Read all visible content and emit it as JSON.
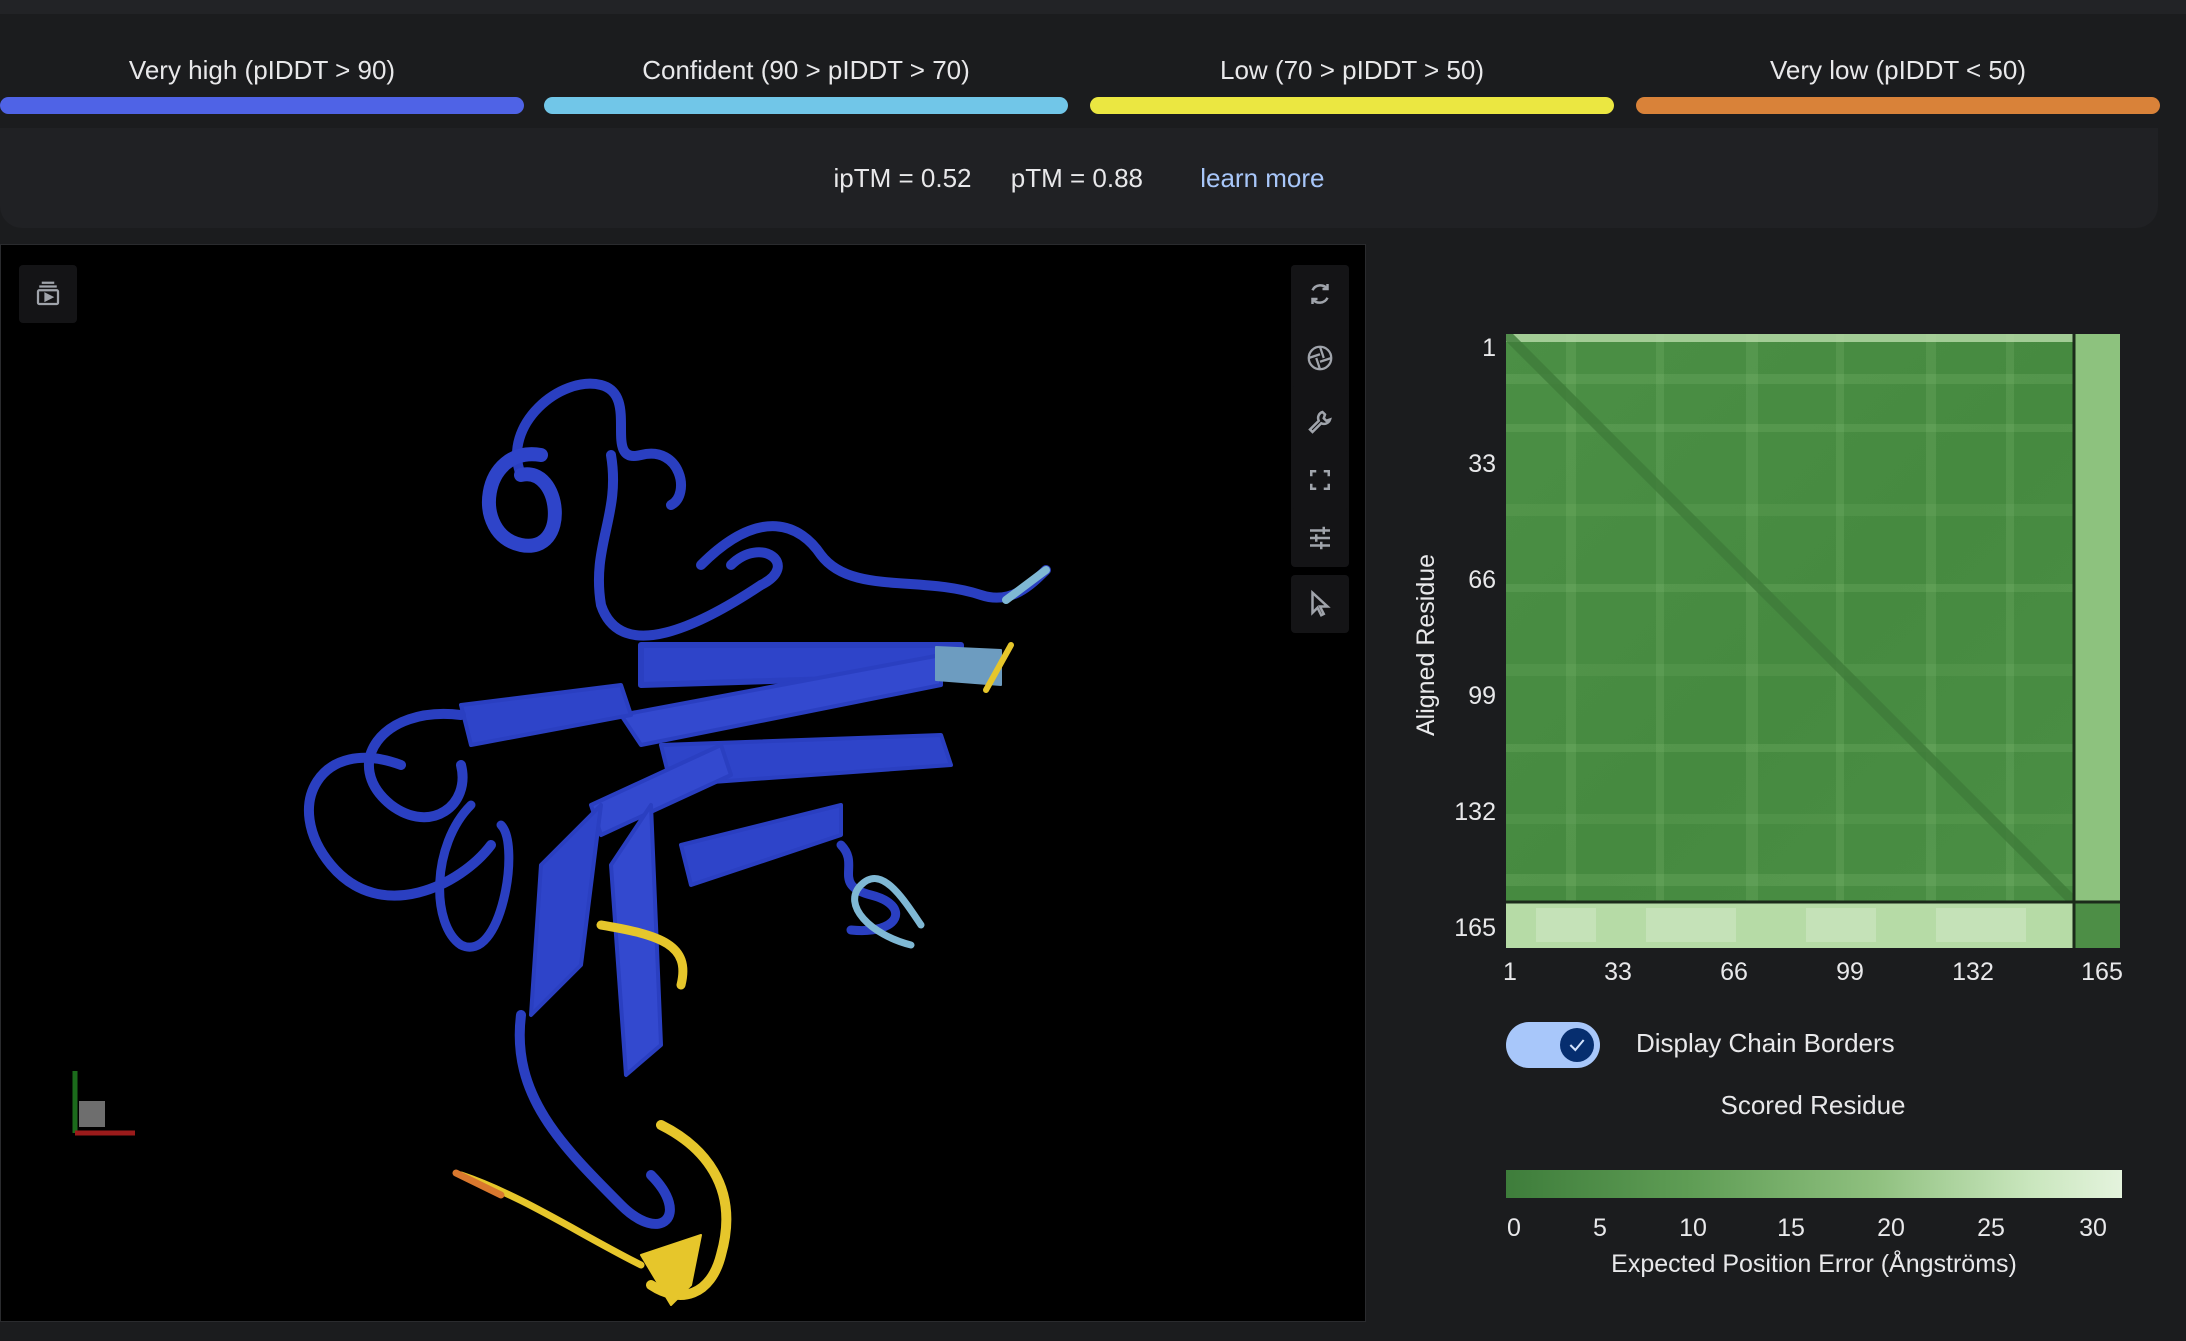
{
  "plddt_legend": [
    {
      "label": "Very high (pIDDT > 90)",
      "color": "#4f63e6"
    },
    {
      "label": "Confident (90 > pIDDT > 70)",
      "color": "#71c6e8"
    },
    {
      "label": "Low (70 > pIDDT > 50)",
      "color": "#ebe741"
    },
    {
      "label": "Very low (pIDDT < 50)",
      "color": "#d98239"
    }
  ],
  "metrics": {
    "iptm": "ipTM = 0.52",
    "ptm": "pTM = 0.88",
    "learn_more": "learn more"
  },
  "viewer": {
    "toolbar_icons": [
      "sequence-view-icon",
      "reset-rotation-icon",
      "screenshot-icon",
      "settings-wrench-icon",
      "fullscreen-icon",
      "controls-sliders-icon",
      "selection-mode-icon"
    ],
    "ribbon_colors": {
      "very_high": "#2a3fc1",
      "confident": "#7fb8d4",
      "low": "#e6c62b",
      "very_low": "#d9782e"
    }
  },
  "pae": {
    "ylabel": "Aligned Residue",
    "yticks": [
      "1",
      "33",
      "66",
      "99",
      "132",
      "165"
    ],
    "xticks": [
      "1",
      "33",
      "66",
      "99",
      "132",
      "165"
    ],
    "toggle_label": "Display Chain Borders",
    "toggle_on": true,
    "xlabel": "Scored Residue",
    "colorbar_ticks": [
      "0",
      "5",
      "10",
      "15",
      "20",
      "25",
      "30"
    ],
    "colorbar_title": "Expected Position Error (Ångströms)",
    "colors": {
      "low": "#3e7d3b",
      "high": "#e4f3dd",
      "border": "#1b2b1a"
    }
  },
  "chart_data": {
    "type": "heatmap",
    "xlabel": "Scored Residue",
    "ylabel": "Aligned Residue",
    "xlim": [
      1,
      165
    ],
    "ylim": [
      1,
      165
    ],
    "x_ticks": [
      1,
      33,
      66,
      99,
      132,
      165
    ],
    "y_ticks": [
      1,
      33,
      66,
      99,
      132,
      165
    ],
    "colorbar": {
      "title": "Expected Position Error (Ångströms)",
      "range": [
        0,
        30
      ],
      "ticks": [
        0,
        5,
        10,
        15,
        20,
        25,
        30
      ]
    },
    "chain_border_residue": 152
  }
}
